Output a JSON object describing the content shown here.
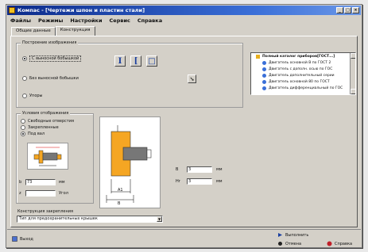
{
  "window": {
    "title": "Компас - [Чертежи шпон и пластин стали]"
  },
  "menu": [
    "Файлы",
    "Режимы",
    "Настройки",
    "Сервис",
    "Справка"
  ],
  "tabs": [
    "Общие данные",
    "Конструкция"
  ],
  "group_top": {
    "legend": "Построение изображения",
    "options": [
      "С выносной бобышкой",
      "Без выносной бобышки",
      "Упоры"
    ],
    "selected": 0
  },
  "toolbar_icons": [
    "I",
    "[",
    "□"
  ],
  "tree": {
    "root": "Полный каталог приборов[ГОСТ...]",
    "items": [
      "Двигатель основной В по ГОСТ 2",
      "Двигатель с дополн. осью по ГОС",
      "Двигатель дополнительный серии",
      "Двигатель основной 80 по ГОСТ",
      "Двигатель дифференциальный по ГОС"
    ]
  },
  "group_mid": {
    "legend": "Условия отображения",
    "options": [
      "Свободные отверстия",
      "Закрепленные",
      "Под вал"
    ],
    "selected": 2
  },
  "fields_left": [
    {
      "label": "b",
      "value": "73",
      "unit": "мм"
    },
    {
      "label": "z",
      "value": "",
      "unit": "Угол"
    }
  ],
  "fields_right": [
    {
      "label": "B",
      "value": "3",
      "unit": "мм"
    },
    {
      "label": "Hr",
      "value": "3",
      "unit": "мм"
    }
  ],
  "drawing_labels": {
    "a": "A1",
    "b": "B"
  },
  "combo": {
    "label": "Конструкция закрепления",
    "value": "Тип для предохранительных крышек"
  },
  "bottom": {
    "left_button": "Выход",
    "right_top": "Выполнить",
    "right_bottom_a": "Отмена",
    "right_bottom_b": "Справка"
  },
  "colors": {
    "title_from": "#0b2a8a",
    "title_to": "#6b98e8",
    "orange": "#f5a623",
    "gray_block": "#777777",
    "icon_blue": "#1a3fa0"
  }
}
